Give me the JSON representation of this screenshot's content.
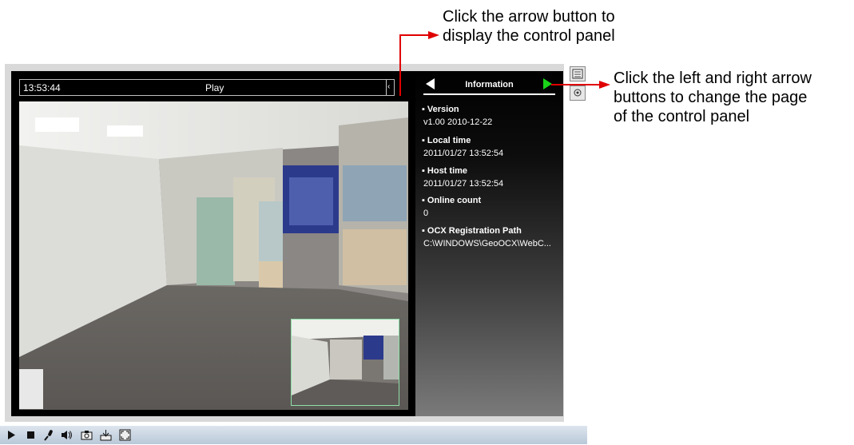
{
  "callouts": {
    "top_line1": "Click the arrow button to",
    "top_line2": "display the control panel",
    "right_line1": "Click the left and right arrow",
    "right_line2": "buttons to change the page",
    "right_line3": "of the control panel"
  },
  "viewer": {
    "time": "13:53:44",
    "status": "Play",
    "pause_glyph": "||"
  },
  "panel": {
    "title": "Information",
    "items": [
      {
        "label": "Version",
        "value": "v1.00  2010-12-22"
      },
      {
        "label": "Local time",
        "value": "2011/01/27 13:52:54"
      },
      {
        "label": "Host time",
        "value": "2011/01/27 13:52:54"
      },
      {
        "label": "Online count",
        "value": "0"
      },
      {
        "label": "OCX Registration Path",
        "value": "C:\\WINDOWS\\GeoOCX\\WebC..."
      }
    ]
  },
  "toolbar": {
    "icons": [
      "play-icon",
      "stop-icon",
      "microphone-icon",
      "speaker-icon",
      "snapshot-icon",
      "save-icon",
      "fullscreen-icon"
    ]
  },
  "colors": {
    "callout_arrow": "#e00000",
    "panel_next_arrow": "#19d419",
    "pip_border": "#8fe0a8"
  }
}
